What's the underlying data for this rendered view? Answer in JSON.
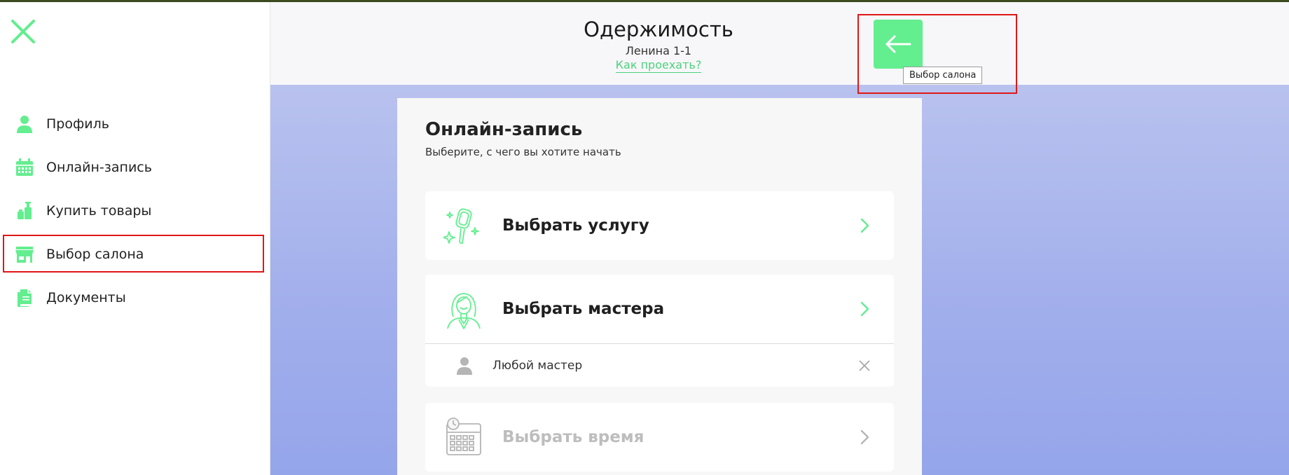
{
  "sidebar": {
    "items": [
      {
        "label": "Профиль",
        "icon": "user-icon"
      },
      {
        "label": "Онлайн-запись",
        "icon": "calendar-icon"
      },
      {
        "label": "Купить товары",
        "icon": "products-icon"
      },
      {
        "label": "Выбор салона",
        "icon": "store-icon"
      },
      {
        "label": "Документы",
        "icon": "documents-icon"
      }
    ]
  },
  "header": {
    "salon_name": "Одержимость",
    "address": "Ленина 1-1",
    "directions_link": "Как проехать?",
    "back_tooltip": "Выбор салона"
  },
  "booking": {
    "title": "Онлайн-запись",
    "subtitle": "Выберите, с чего вы хотите начать",
    "options": [
      {
        "label": "Выбрать услугу",
        "icon": "hand-mirror-icon",
        "enabled": true
      },
      {
        "label": "Выбрать мастера",
        "icon": "master-icon",
        "enabled": true,
        "selected_value": "Любой мастер"
      },
      {
        "label": "Выбрать время",
        "icon": "calendar-time-icon",
        "enabled": false
      }
    ]
  },
  "colors": {
    "accent": "#63ee8f",
    "link": "#4dd27c",
    "highlight": "#e01717",
    "disabled": "#bdbdbd"
  }
}
